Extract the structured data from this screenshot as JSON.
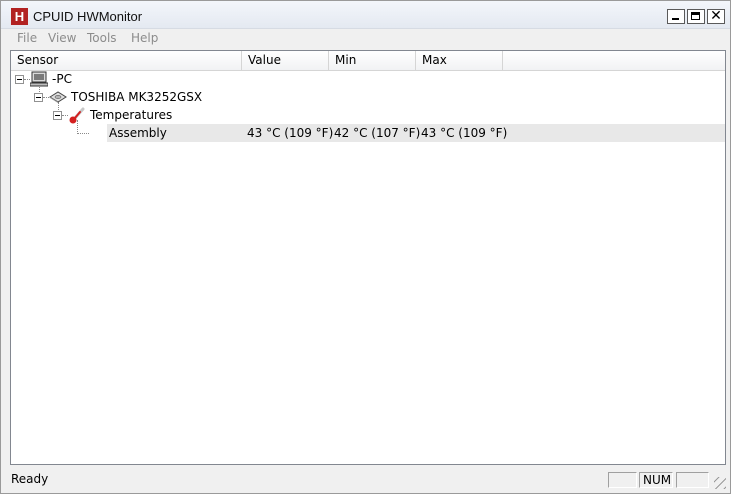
{
  "window": {
    "title": "CPUID HWMonitor",
    "icon_letter": "H",
    "accent": "#b22222"
  },
  "controls": {
    "minimize": "minimize",
    "maximize": "maximize",
    "close": "✕"
  },
  "menu": [
    "File",
    "View",
    "Tools",
    "Help"
  ],
  "columns": {
    "sensor": "Sensor",
    "value": "Value",
    "min": "Min",
    "max": "Max"
  },
  "tree": {
    "computer": {
      "label": "-PC",
      "icon": "computer-icon"
    },
    "disk": {
      "label": "TOSHIBA MK3252GSX",
      "icon": "hard-disk-icon"
    },
    "group": {
      "label": "Temperatures",
      "icon": "thermometer-icon"
    },
    "sensor": {
      "label": "Assembly",
      "value": "43 °C  (109 °F)",
      "min": "42 °C  (107 °F)",
      "max": "43 °C  (109 °F)"
    }
  },
  "status": {
    "text": "Ready",
    "num": "NUM"
  }
}
